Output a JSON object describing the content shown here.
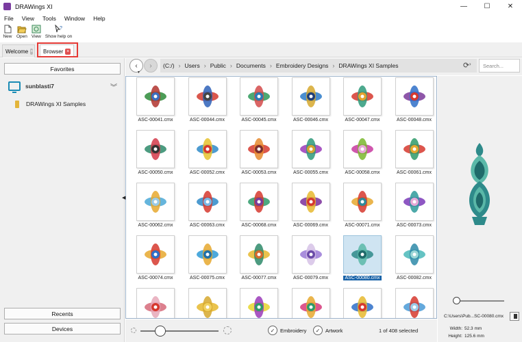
{
  "window": {
    "title": "DRAWings XI",
    "controls": {
      "minimize": "—",
      "maximize": "☐",
      "close": "✕"
    }
  },
  "menu": [
    "File",
    "View",
    "Tools",
    "Window",
    "Help"
  ],
  "toolbar": [
    {
      "label": "New",
      "icon": "new-document-icon"
    },
    {
      "label": "Open",
      "icon": "open-folder-icon"
    },
    {
      "label": "View",
      "icon": "view-icon"
    },
    {
      "label": "Show help on",
      "icon": "help-pointer-icon"
    }
  ],
  "tabs": [
    {
      "label": "Welcome",
      "active": false
    },
    {
      "label": "Browser",
      "active": true
    }
  ],
  "left_panel": {
    "favorites_label": "Favorites",
    "computer_name": "sunblasti7",
    "folder_name": "DRAWings XI Samples",
    "recents_label": "Recents",
    "devices_label": "Devices"
  },
  "nav": {
    "breadcrumb": [
      "(C:/)",
      "Users",
      "Public",
      "Documents",
      "Embroidery Designs",
      "DRAWings XI Samples"
    ],
    "search_placeholder": "Search..."
  },
  "files": [
    {
      "name": "ASC-00041.cmx",
      "colors": [
        "#2e8b3a",
        "#b0322e",
        "#3a6fbf"
      ]
    },
    {
      "name": "ASC-00044.cmx",
      "colors": [
        "#d33a2e",
        "#2e62b8",
        "#444444"
      ]
    },
    {
      "name": "ASC-00045.cmx",
      "colors": [
        "#2e9a5a",
        "#d34a4a",
        "#2a7ab8"
      ]
    },
    {
      "name": "ASC-00046.cmx",
      "colors": [
        "#2a7ac8",
        "#d6a82e",
        "#1f3f7a"
      ]
    },
    {
      "name": "ASC-00047.cmx",
      "colors": [
        "#d6382e",
        "#2e9a7a",
        "#e6a22e"
      ]
    },
    {
      "name": "ASC-00048.cmx",
      "colors": [
        "#7a3a9a",
        "#2e6fc8",
        "#d6382e"
      ]
    },
    {
      "name": "ASC-00050.cmx",
      "colors": [
        "#2e8a6a",
        "#d33a4a",
        "#333333"
      ]
    },
    {
      "name": "ASC-00052.cmx",
      "colors": [
        "#2e8ac8",
        "#e6c22e",
        "#d6382e"
      ]
    },
    {
      "name": "ASC-00053.cmx",
      "colors": [
        "#d6382e",
        "#e68a2e",
        "#7a2e2e"
      ]
    },
    {
      "name": "ASC-00055.cmx",
      "colors": [
        "#9a3ab8",
        "#2e9a7a",
        "#d6a22e"
      ]
    },
    {
      "name": "ASC-00058.cmx",
      "colors": [
        "#c83aa0",
        "#7ab82e",
        "#e6a8d6"
      ]
    },
    {
      "name": "ASC-00061.cmx",
      "colors": [
        "#d6382e",
        "#2e9a6a",
        "#e6a82e"
      ]
    },
    {
      "name": "ASC-00062.cmx",
      "colors": [
        "#4aa8d6",
        "#e6a82e",
        "#9acae6"
      ]
    },
    {
      "name": "ASC-00063.cmx",
      "colors": [
        "#2e8ac8",
        "#d6382e",
        "#7ab8e6"
      ]
    },
    {
      "name": "ASC-00068.cmx",
      "colors": [
        "#2e9a6a",
        "#d6382e",
        "#7a3a9a"
      ]
    },
    {
      "name": "ASC-00069.cmx",
      "colors": [
        "#7a2e9a",
        "#e6b82e",
        "#d6382e"
      ]
    },
    {
      "name": "ASC-00071.cmx",
      "colors": [
        "#e6a82e",
        "#d6382e",
        "#2e8a9a"
      ]
    },
    {
      "name": "ASC-00073.cmx",
      "colors": [
        "#7a3ab8",
        "#2e9a9a",
        "#e6a8d6"
      ]
    },
    {
      "name": "ASC-00074.cmx",
      "colors": [
        "#e6a82e",
        "#d6382e",
        "#2e6fc8"
      ]
    },
    {
      "name": "ASC-00075.cmx",
      "colors": [
        "#2e9ad6",
        "#e6a82e",
        "#1f6fa8"
      ]
    },
    {
      "name": "ASC-00077.cmx",
      "colors": [
        "#e6b82e",
        "#2e8a6a",
        "#d66a2e"
      ]
    },
    {
      "name": "ASC-00079.cmx",
      "colors": [
        "#9a7ad6",
        "#d6c2e6",
        "#6a4aa8"
      ]
    },
    {
      "name": "ASC-00080.cmx",
      "colors": [
        "#2e8a8a",
        "#5ab8a8",
        "#1f6a6a"
      ],
      "selected": true
    },
    {
      "name": "ASC-00082.cmx",
      "colors": [
        "#4ab8b8",
        "#2e8aa8",
        "#9ad6d6"
      ]
    },
    {
      "name": "",
      "colors": [
        "#d66a7a",
        "#e6a8b8",
        "#d6382e"
      ]
    },
    {
      "name": "",
      "colors": [
        "#e6b82e",
        "#d6a82e",
        "#f0d060"
      ]
    },
    {
      "name": "",
      "colors": [
        "#e6d62e",
        "#9a3ab8",
        "#2e9a6a"
      ]
    },
    {
      "name": "",
      "colors": [
        "#d6387a",
        "#e6a82e",
        "#2e9a6a"
      ]
    },
    {
      "name": "",
      "colors": [
        "#2e6fc8",
        "#e6b82e",
        "#d6382e"
      ]
    },
    {
      "name": "",
      "colors": [
        "#4a9ad6",
        "#d6382e",
        "#9acae6"
      ]
    }
  ],
  "preview": {
    "path": "C:\\Users\\Pub...SC-00080.cmx",
    "width_label": "Width:",
    "width_value": "52.3 mm",
    "height_label": "Height:",
    "height_value": "125.6 mm",
    "zoom_level": 0.0,
    "design_colors": [
      "#2e8a8a",
      "#5ab8a8",
      "#1f6a6a"
    ]
  },
  "bottom": {
    "thumbnail_size": 0.25,
    "embroidery_label": "Embroidery",
    "artwork_label": "Artwork",
    "selection_text": "1 of 408 selected"
  }
}
